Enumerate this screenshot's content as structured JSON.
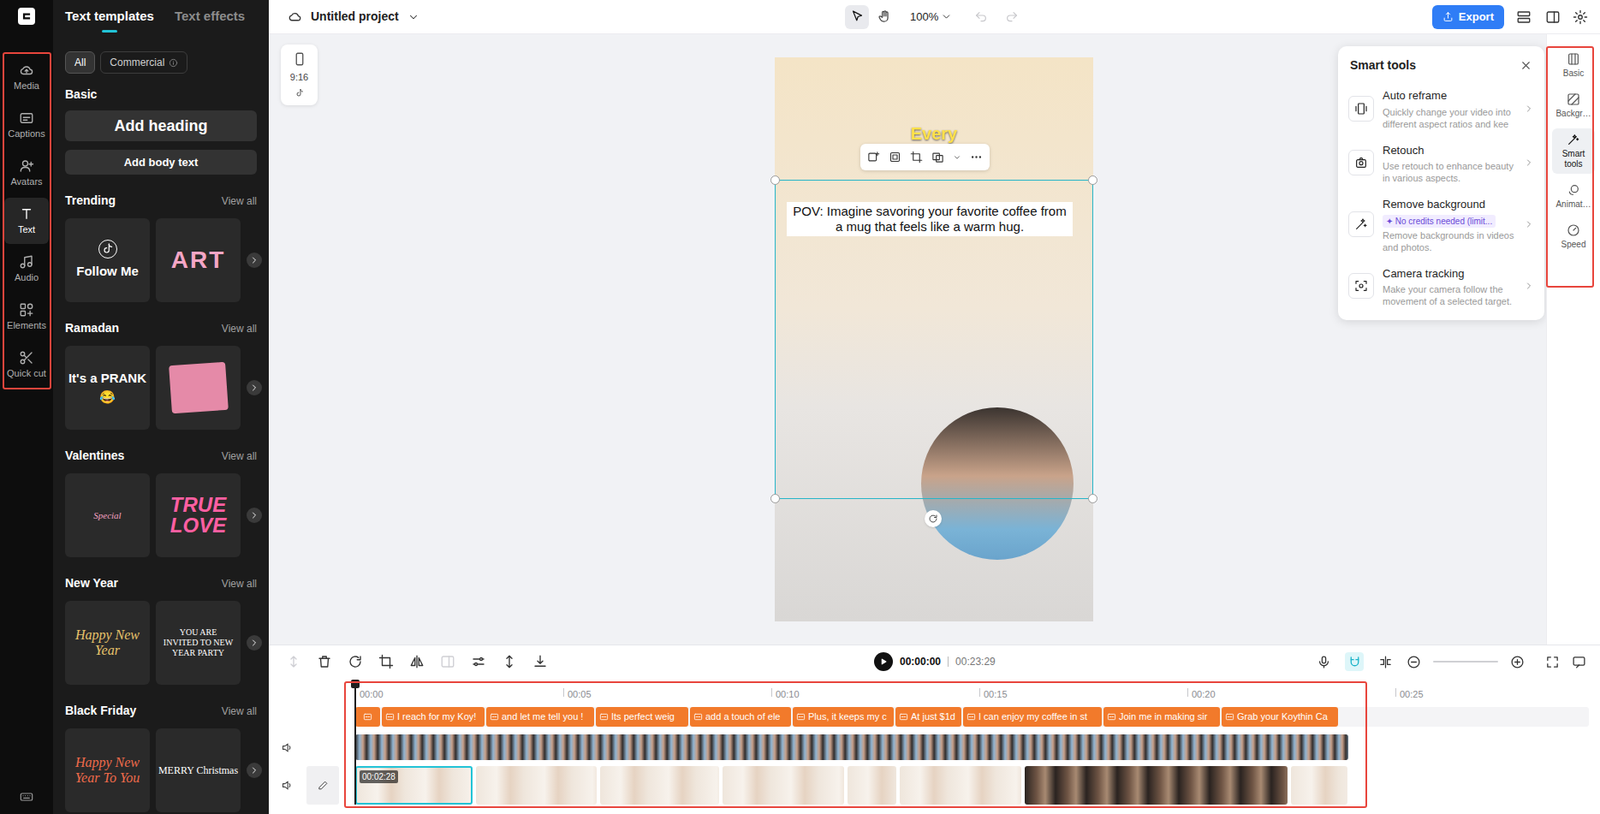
{
  "project": {
    "title": "Untitled project",
    "zoom": "100%",
    "export": "Export"
  },
  "canvas_tools": [
    {
      "selected": true
    },
    {
      "selected": false
    }
  ],
  "history": {
    "undo_disabled": true,
    "redo_disabled": true
  },
  "left_rail": [
    {
      "label": "Media",
      "selected": false
    },
    {
      "label": "Captions",
      "selected": false
    },
    {
      "label": "Avatars",
      "selected": false
    },
    {
      "label": "Text",
      "selected": true
    },
    {
      "label": "Audio",
      "selected": false
    },
    {
      "label": "Elements",
      "selected": false
    },
    {
      "label": "Quick cut",
      "selected": false
    }
  ],
  "panel": {
    "tabs": [
      {
        "label": "Text templates",
        "selected": true
      },
      {
        "label": "Text effects",
        "selected": false
      }
    ],
    "filters": [
      {
        "label": "All",
        "selected": true
      },
      {
        "label": "Commercial",
        "selected": false
      }
    ],
    "basic": {
      "title": "Basic",
      "heading": "Add heading",
      "body": "Add body text"
    },
    "sections": [
      {
        "title": "Trending",
        "view_all": "View all",
        "cards": [
          {
            "text": "Follow Me",
            "kind": "follow"
          },
          {
            "text": "ART",
            "kind": "art"
          }
        ]
      },
      {
        "title": "Ramadan",
        "view_all": "View all",
        "cards": [
          {
            "text": "It's a PRANK 😂",
            "kind": "prank"
          },
          {
            "kind": "card"
          }
        ]
      },
      {
        "title": "Valentines",
        "view_all": "View all",
        "cards": [
          {
            "text": "Special",
            "kind": "script"
          },
          {
            "text": "TRUE LOVE",
            "kind": "love"
          }
        ]
      },
      {
        "title": "New Year",
        "view_all": "View all",
        "cards": [
          {
            "text": "Happy New Year",
            "kind": "gold"
          },
          {
            "text": "YOU ARE INVITED TO NEW YEAR PARTY",
            "kind": "serif"
          }
        ]
      },
      {
        "title": "Black Friday",
        "view_all": "View all",
        "cards": [
          {
            "text": "Happy New Year To You",
            "kind": "red"
          },
          {
            "text": "MERRY Christmas",
            "kind": "merry"
          }
        ]
      }
    ]
  },
  "canvas": {
    "aspect": "9:16",
    "caption": "Every",
    "text": "POV: Imagine savoring your favorite coffee from a mug that feels like a warm hug.",
    "selected": true
  },
  "smart_tools": {
    "title": "Smart tools",
    "items": [
      {
        "title": "Auto reframe",
        "desc": "Quickly change your video into different aspect ratios and kee"
      },
      {
        "title": "Retouch",
        "desc": "Use retouch to enhance beauty in various aspects."
      },
      {
        "title": "Remove background",
        "badge": "✦ No credits needed (limit...",
        "desc": "Remove backgrounds in videos and photos."
      },
      {
        "title": "Camera tracking",
        "desc": "Make your camera follow the movement of a selected target."
      }
    ]
  },
  "right_rail": [
    {
      "label": "Basic",
      "selected": false
    },
    {
      "label": "Backgr…",
      "selected": false
    },
    {
      "label": "Smart tools",
      "selected": true
    },
    {
      "label": "Animat…",
      "selected": false
    },
    {
      "label": "Speed",
      "selected": false
    }
  ],
  "timeline": {
    "tools": [
      {
        "disabled": true
      },
      {
        "disabled": false
      },
      {
        "disabled": false
      },
      {
        "disabled": false
      },
      {
        "disabled": false
      },
      {
        "disabled": true
      },
      {
        "disabled": false
      },
      {
        "disabled": false
      },
      {
        "disabled": false
      }
    ],
    "time": "00:00:00",
    "duration": "00:23:29",
    "right_tools": [
      {
        "selected": false
      },
      {
        "selected": true
      },
      {
        "selected": false
      }
    ],
    "ticks": [
      "00:00",
      "00:05",
      "00:10",
      "00:15",
      "00:20",
      "00:25"
    ],
    "captions": [
      "I reach for my Koy!",
      "and let me tell you !",
      "Its perfect weig",
      "add a touch of ele",
      "Plus, it keeps my c",
      "At just $1d",
      "I can enjoy my coffee in st",
      "Join me in making sir",
      "Grab your Koythin Ca"
    ],
    "clips": [
      {
        "selected": true,
        "label": "00:02:28",
        "kind": "light"
      },
      {
        "selected": false,
        "kind": "light"
      },
      {
        "selected": false,
        "kind": "light"
      },
      {
        "selected": false,
        "kind": "light"
      },
      {
        "selected": false,
        "kind": "light"
      },
      {
        "selected": false,
        "kind": "light"
      },
      {
        "selected": false,
        "kind": "dark"
      },
      {
        "selected": false,
        "kind": "light"
      }
    ]
  }
}
